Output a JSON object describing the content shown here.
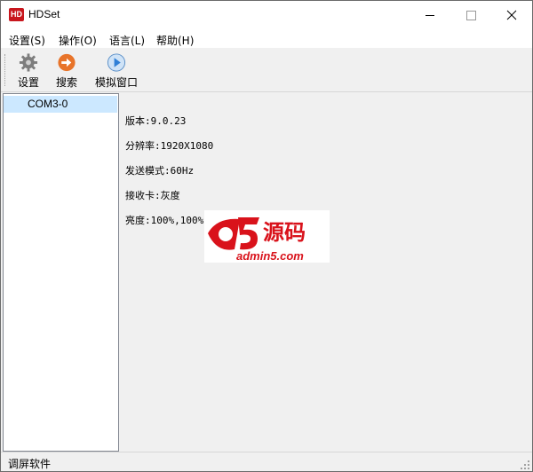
{
  "window": {
    "title": "HDSet",
    "app_icon_text": "HD"
  },
  "menu": [
    {
      "label": "设置(S)"
    },
    {
      "label": "操作(O)"
    },
    {
      "label": "语言(L)"
    },
    {
      "label": "帮助(H)"
    }
  ],
  "toolbar": {
    "settings_label": "设置",
    "search_label": "搜索",
    "simulate_label": "模拟窗口"
  },
  "tree": {
    "items": [
      {
        "label": "COM3-0",
        "selected": true
      }
    ]
  },
  "info": {
    "version": "版本:9.0.23",
    "resolution": "分辨率:1920X1080",
    "send_mode": "发送模式:60Hz",
    "receiver": "接收卡:灰度",
    "brightness": "亮度:100%,100%"
  },
  "watermark": {
    "brand": "a5源码",
    "url": "admin5.com"
  },
  "status": {
    "text": "调屏软件"
  },
  "colors": {
    "selection": "#cce8ff",
    "logo_red": "#d9121b",
    "icon_blue": "#2f7fd6",
    "icon_orange": "#e8742a"
  }
}
